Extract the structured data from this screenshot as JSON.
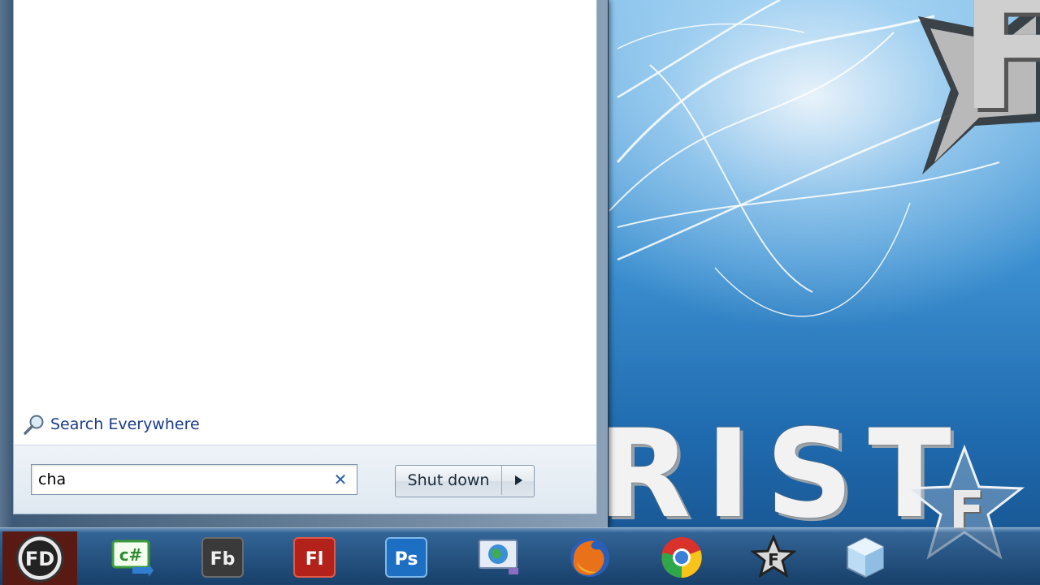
{
  "start_menu": {
    "search_scope_label": "Search Everywhere",
    "search_value": "cha",
    "shutdown_label": "Shut down"
  },
  "taskbar": {
    "start_orb_label": "FD",
    "pinned": [
      {
        "id": "csharp",
        "icon": "csharp-icon",
        "text": "c#",
        "color": "#2e8b2e"
      },
      {
        "id": "flash-builder",
        "icon": "flash-builder-icon",
        "text": "Fb",
        "color": "#3a3a3a"
      },
      {
        "id": "flash",
        "icon": "flash-icon",
        "text": "Fl",
        "color": "#b3211b"
      },
      {
        "id": "photoshop",
        "icon": "photoshop-icon",
        "text": "Ps",
        "color": "#1c6fc2"
      },
      {
        "id": "network",
        "icon": "globe-monitor-icon",
        "text": "",
        "color": "#6a7fa8"
      },
      {
        "id": "firefox",
        "icon": "firefox-icon",
        "text": "",
        "color": "#e8711a"
      },
      {
        "id": "chrome",
        "icon": "chrome-icon",
        "text": "",
        "color": "#2ea84a"
      },
      {
        "id": "star-app",
        "icon": "star-f-icon",
        "text": "F",
        "color": "#7a7a7a"
      },
      {
        "id": "cube-app",
        "icon": "cube-icon",
        "text": "",
        "color": "#9ec7ea"
      }
    ]
  },
  "wallpaper": {
    "text": "RIST",
    "logo_letter": "F",
    "star_letter": "F"
  }
}
